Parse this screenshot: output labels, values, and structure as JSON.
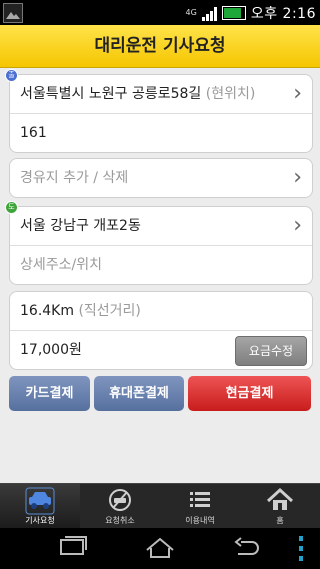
{
  "status": {
    "network": "4G",
    "clock": "오후 2:16"
  },
  "header": {
    "title": "대리운전 기사요청"
  },
  "origin": {
    "address": "서울특별시 노원구 공릉로58길",
    "tag": "(현위치)",
    "detail": "161",
    "pin_label": "출"
  },
  "waypoint": {
    "label": "경유지 추가 / 삭제"
  },
  "destination": {
    "address": "서울 강남구 개포2동",
    "detail_placeholder": "상세주소/위치",
    "pin_label": "도"
  },
  "fare": {
    "distance": "16.4Km",
    "distance_note": "(직선거리)",
    "amount": "17,000원",
    "edit_label": "요금수정"
  },
  "payment": {
    "card": "카드결제",
    "phone": "휴대폰결제",
    "cash": "현금결제"
  },
  "tabs": [
    {
      "label": "기사요청",
      "icon": "car-icon"
    },
    {
      "label": "요청취소",
      "icon": "cancel-car-icon"
    },
    {
      "label": "이용내역",
      "icon": "list-icon"
    },
    {
      "label": "홈",
      "icon": "home-icon"
    }
  ],
  "colors": {
    "header": "#f5c600",
    "pay_blue": "#56709e",
    "pay_red": "#c81c1c",
    "tabbar": "#272727"
  }
}
